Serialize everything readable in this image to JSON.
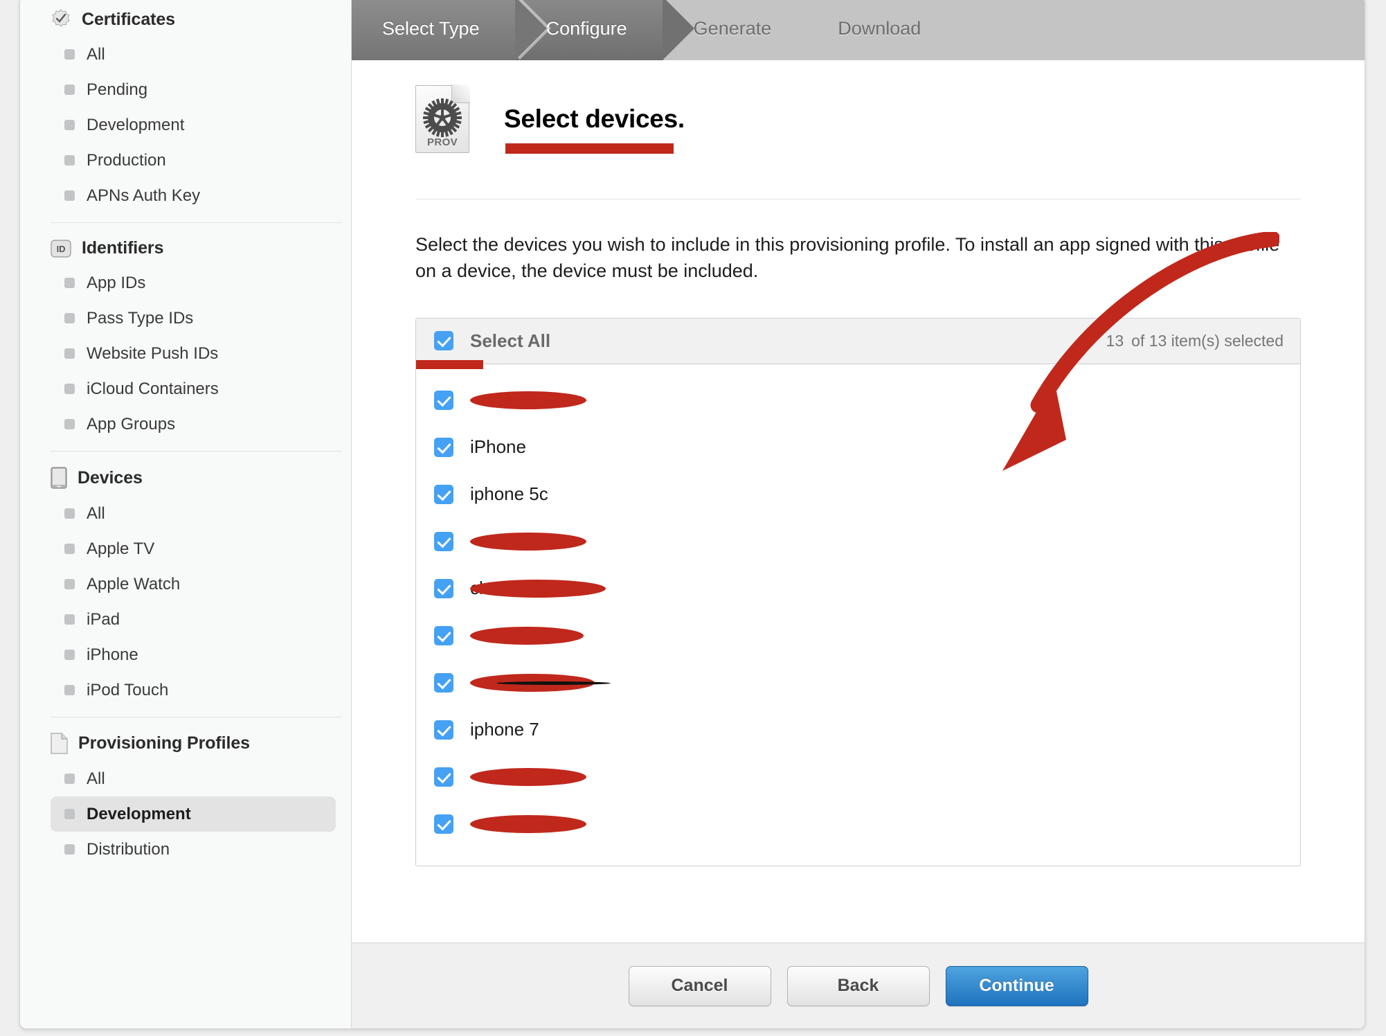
{
  "steps": [
    {
      "label": "Select Type",
      "state": "done"
    },
    {
      "label": "Configure",
      "state": "current"
    },
    {
      "label": "Generate",
      "state": "future"
    },
    {
      "label": "Download",
      "state": "future"
    }
  ],
  "sidebar": {
    "groups": [
      {
        "title": "Certificates",
        "icon": "certificate-badge-icon",
        "items": [
          {
            "label": "All",
            "selected": false
          },
          {
            "label": "Pending",
            "selected": false
          },
          {
            "label": "Development",
            "selected": false
          },
          {
            "label": "Production",
            "selected": false
          },
          {
            "label": "APNs Auth Key",
            "selected": false
          }
        ]
      },
      {
        "title": "Identifiers",
        "icon": "id-badge-icon",
        "items": [
          {
            "label": "App IDs",
            "selected": false
          },
          {
            "label": "Pass Type IDs",
            "selected": false
          },
          {
            "label": "Website Push IDs",
            "selected": false
          },
          {
            "label": "iCloud Containers",
            "selected": false
          },
          {
            "label": "App Groups",
            "selected": false
          }
        ]
      },
      {
        "title": "Devices",
        "icon": "device-icon",
        "items": [
          {
            "label": "All",
            "selected": false
          },
          {
            "label": "Apple TV",
            "selected": false
          },
          {
            "label": "Apple Watch",
            "selected": false
          },
          {
            "label": "iPad",
            "selected": false
          },
          {
            "label": "iPhone",
            "selected": false
          },
          {
            "label": "iPod Touch",
            "selected": false
          }
        ]
      },
      {
        "title": "Provisioning Profiles",
        "icon": "document-icon",
        "items": [
          {
            "label": "All",
            "selected": false
          },
          {
            "label": "Development",
            "selected": true
          },
          {
            "label": "Distribution",
            "selected": false
          }
        ]
      }
    ]
  },
  "main": {
    "icon_label": "PROV",
    "title": "Select devices.",
    "description": "Select the devices you wish to include in this provisioning profile. To install an app signed with this profile on a device, the device must be included.",
    "list": {
      "select_all_label": "Select All",
      "count_selected": "13",
      "count_text": "of 13 item(s) selected",
      "rows": [
        {
          "label": "",
          "checked": true,
          "redacted": true,
          "redact_width": 168,
          "scribble": false
        },
        {
          "label": "iPhone",
          "checked": true,
          "redacted": false,
          "redact_width": 0,
          "scribble": false
        },
        {
          "label": "iphone 5c",
          "checked": true,
          "redacted": false,
          "redact_width": 0,
          "scribble": false
        },
        {
          "label": "",
          "checked": true,
          "redacted": true,
          "redact_width": 168,
          "scribble": false
        },
        {
          "label": "ch",
          "checked": true,
          "redacted": true,
          "redact_width": 196,
          "scribble": false
        },
        {
          "label": "",
          "checked": true,
          "redacted": true,
          "redact_width": 164,
          "scribble": false
        },
        {
          "label": "",
          "checked": true,
          "redacted": true,
          "redact_width": 180,
          "scribble": true
        },
        {
          "label": "iphone 7",
          "checked": true,
          "redacted": false,
          "redact_width": 0,
          "scribble": false
        },
        {
          "label": "",
          "checked": true,
          "redacted": true,
          "redact_width": 168,
          "scribble": false
        },
        {
          "label": "",
          "checked": true,
          "redacted": true,
          "redact_width": 168,
          "scribble": false
        }
      ]
    }
  },
  "footer": {
    "cancel_label": "Cancel",
    "back_label": "Back",
    "continue_label": "Continue"
  },
  "colors": {
    "annotation_red": "#c0281c",
    "checkbox_blue": "#45a1f3",
    "primary_button_blue": "#1f73bd"
  }
}
